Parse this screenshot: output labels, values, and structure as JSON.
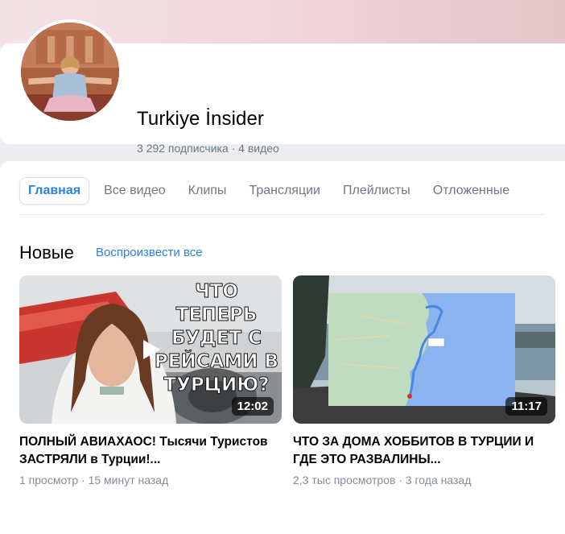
{
  "channel": {
    "name": "Turkiye İnsider",
    "stats": "3 292 подписчика · 4 видео"
  },
  "tabs": [
    {
      "label": "Главная"
    },
    {
      "label": "Все видео"
    },
    {
      "label": "Клипы"
    },
    {
      "label": "Трансляции"
    },
    {
      "label": "Плейлисты"
    },
    {
      "label": "Отложенные"
    }
  ],
  "section": {
    "title": "Новые",
    "play_all": "Воспроизвести все"
  },
  "videos": [
    {
      "title": "ПОЛНЫЙ АВИАХАОС! Тысячи Туристов ЗАСТРЯЛИ в Турции!...",
      "meta": "1 просмотр · 15 минут назад",
      "duration": "12:02",
      "thumb_text": "ЧТО ТЕПЕРЬ БУДЕТ С РЕЙСАМИ В ТУРЦИЮ?"
    },
    {
      "title": "ЧТО ЗА ДОМА ХОББИТОВ В ТУРЦИИ И ГДЕ ЭТО РАЗВАЛИНЫ...",
      "meta": "2,3 тыс просмотров · 3 года назад",
      "duration": "11:17"
    }
  ],
  "colors": {
    "accent": "#2d81e0",
    "secondary_text": "#6d7885",
    "background": "#ebedf0"
  }
}
